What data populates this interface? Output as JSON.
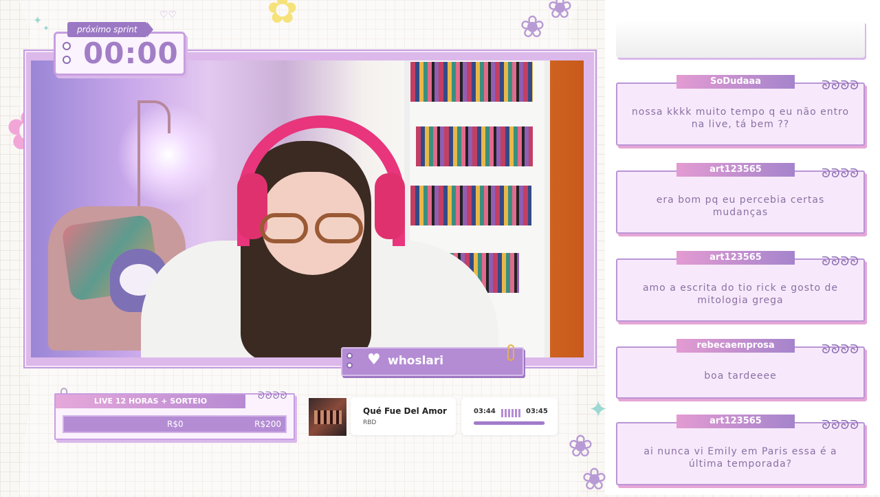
{
  "timer": {
    "label": "próximo sprint",
    "value": "00:00"
  },
  "streamer": {
    "name": "whoslari"
  },
  "goal": {
    "title": "LIVE 12 HORAS + SORTEIO",
    "current": "R$0",
    "target": "R$200",
    "progress": 0
  },
  "music": {
    "title": "Qué Fue Del Amor",
    "artist": "RBD",
    "elapsed": "03:44",
    "duration": "03:45",
    "progress": 0.99
  },
  "chat": [
    {
      "user": "SoDudaaa",
      "text": "nossa kkkk muito tempo q eu não entro na live, tá bem ??"
    },
    {
      "user": "art123565",
      "text": "era bom pq eu percebia certas mudanças"
    },
    {
      "user": "art123565",
      "text": "amo a escrita do tio rick e gosto de mitologia grega"
    },
    {
      "user": "rebecaemprosa",
      "text": "boa tardeeee"
    },
    {
      "user": "art123565",
      "text": "ai nunca vi Emily em Paris essa é a última temporada?"
    }
  ],
  "colors": {
    "accent": "#b48cd4",
    "pink": "#e6a5d6",
    "headphones": "#e8357c"
  }
}
